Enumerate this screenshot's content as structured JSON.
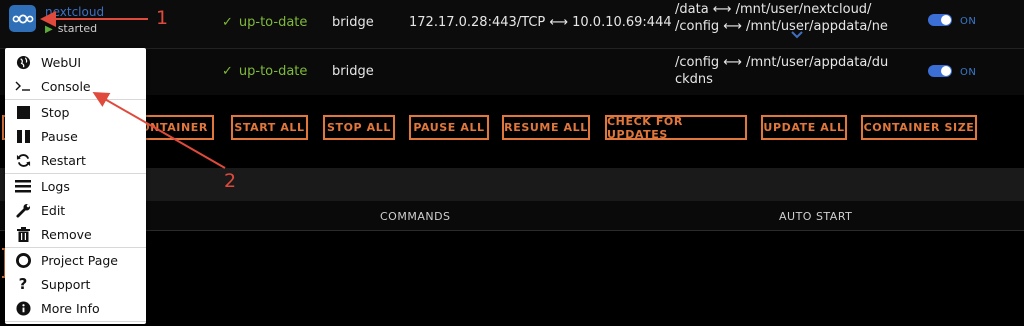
{
  "rows": [
    {
      "name": "nextcloud",
      "status": "started",
      "version": "up-to-date",
      "network": "bridge",
      "port_mappings": "172.17.0.28:443/TCP ⟷ 10.0.10.69:444",
      "volume_lines": [
        "/data ⟷ /mnt/user/nextcloud/",
        "/config ⟷ /mnt/user/appdata/ne"
      ],
      "autostart": "ON"
    },
    {
      "version": "up-to-date",
      "network": "bridge",
      "volume_lines": [
        "/config ⟷ /mnt/user/appdata/du",
        "ckdns"
      ],
      "autostart": "ON"
    }
  ],
  "buttons": {
    "add_container_partial": "ONTAINER",
    "start_all": "START ALL",
    "stop_all": "STOP ALL",
    "pause_all": "PAUSE ALL",
    "resume_all": "RESUME ALL",
    "check_updates": "CHECK FOR UPDATES",
    "update_all": "UPDATE ALL",
    "container_size": "CONTAINER SIZE"
  },
  "table_headers": {
    "commands": "COMMANDS",
    "autostart": "AUTO START"
  },
  "context_menu": {
    "items": [
      {
        "label": "WebUI",
        "icon": "globe-icon"
      },
      {
        "label": "Console",
        "icon": "terminal-icon"
      },
      {
        "label": "Stop",
        "icon": "stop-icon"
      },
      {
        "label": "Pause",
        "icon": "pause-icon"
      },
      {
        "label": "Restart",
        "icon": "restart-icon"
      },
      {
        "label": "Logs",
        "icon": "list-icon"
      },
      {
        "label": "Edit",
        "icon": "wrench-icon"
      },
      {
        "label": "Remove",
        "icon": "trash-icon"
      },
      {
        "label": "Project Page",
        "icon": "lifebuoy-icon"
      },
      {
        "label": "Support",
        "icon": "question-icon"
      },
      {
        "label": "More Info",
        "icon": "info-icon"
      }
    ]
  },
  "annotations": {
    "one": "1",
    "two": "2"
  },
  "colors": {
    "accent_orange": "#e2773b",
    "status_green": "#7fba3a",
    "link_blue": "#3f6fbf",
    "annotation_red": "#e04a3c"
  }
}
